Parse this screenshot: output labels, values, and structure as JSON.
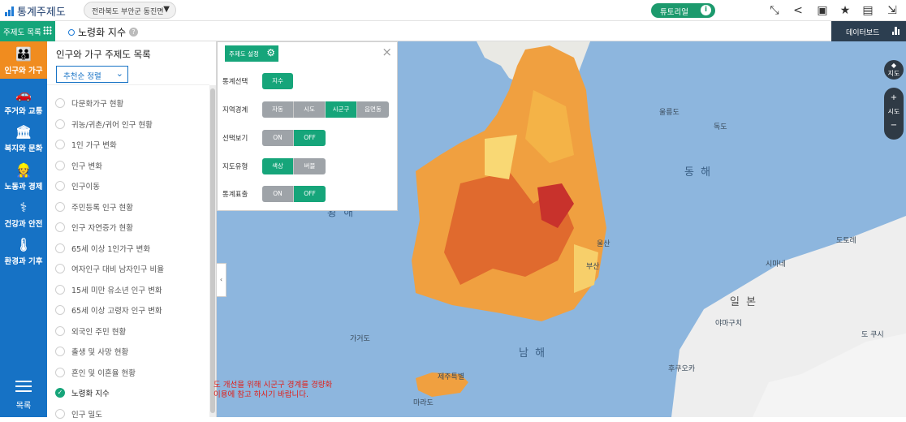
{
  "app": {
    "title": "통계주제도"
  },
  "header": {
    "region": "전라북도 부안군 동진면",
    "tutorial_label": "튜토리얼",
    "tutorial_info_icon": "i"
  },
  "subbar": {
    "theme_list_label": "주제도 목록",
    "current_theme": "노령화 지수",
    "help_icon": "?",
    "dashboard_label": "데이터보드"
  },
  "nav": {
    "items": [
      {
        "label": "인구와 가구",
        "icon": "people-icon",
        "glyph": "👪"
      },
      {
        "label": "주거와 교통",
        "icon": "car-house-icon",
        "glyph": "🚗"
      },
      {
        "label": "복지와 문화",
        "icon": "building-icon",
        "glyph": "🏛"
      },
      {
        "label": "노동과 경제",
        "icon": "worker-icon",
        "glyph": "👷"
      },
      {
        "label": "건강과 안전",
        "icon": "health-icon",
        "glyph": "⚕"
      },
      {
        "label": "환경과 기후",
        "icon": "thermometer-icon",
        "glyph": "🌡"
      }
    ],
    "menu_label": "목록"
  },
  "panel": {
    "title": "인구와 가구 주제도 목록",
    "sort_label": "추천순 정렬",
    "topics": [
      "다문화가구 현황",
      "귀농/귀촌/귀어 인구 현황",
      "1인 가구 변화",
      "인구 변화",
      "인구이동",
      "주민등록 인구 현황",
      "인구 자연증가 현황",
      "65세 이상 1인가구 변화",
      "여자인구 대비 남자인구 비율",
      "15세 미만 유소년 인구 변화",
      "65세 이상 고령자 인구 변화",
      "외국인 주민 현황",
      "출생 및 사망 현황",
      "혼인 및 이혼율 현황",
      "노령화 지수",
      "인구 밀도"
    ],
    "selected": "노령화 지수"
  },
  "settings": {
    "tab_label": "주제도 설정",
    "rows": [
      {
        "label": "통계선택",
        "options": [
          "지수"
        ],
        "active": 0
      },
      {
        "label": "지역경계",
        "options": [
          "자동",
          "시도",
          "시군구",
          "읍면동"
        ],
        "active": 2
      },
      {
        "label": "선택보기",
        "options": [
          "ON",
          "OFF"
        ],
        "active": 1
      },
      {
        "label": "지도유형",
        "options": [
          "색상",
          "버블"
        ],
        "active": 0
      },
      {
        "label": "통계표출",
        "options": [
          "ON",
          "OFF"
        ],
        "active": 1
      }
    ]
  },
  "map": {
    "seas": {
      "east": "동 해",
      "south": "남 해",
      "yellow": "황 해",
      "japan": "일 본"
    },
    "labels": {
      "ulleung": "울릉도",
      "dokdo": "독도",
      "ulsan": "울산",
      "busan": "부산",
      "gageo": "가거도",
      "jeju": "제주특별",
      "marado": "마라도",
      "dotore": "도토레",
      "shimane": "시마네",
      "yamaguchi": "야마구치",
      "kumamoto": "후쿠오카",
      "gochi": "도 쿠시"
    },
    "controls": {
      "map_label": "지도",
      "sido_label": "시도"
    }
  },
  "notice": {
    "line1": "도 개선을 위해 시군구 경계를 경량화",
    "line2": "이용에 참고 하시기 바랍니다."
  }
}
